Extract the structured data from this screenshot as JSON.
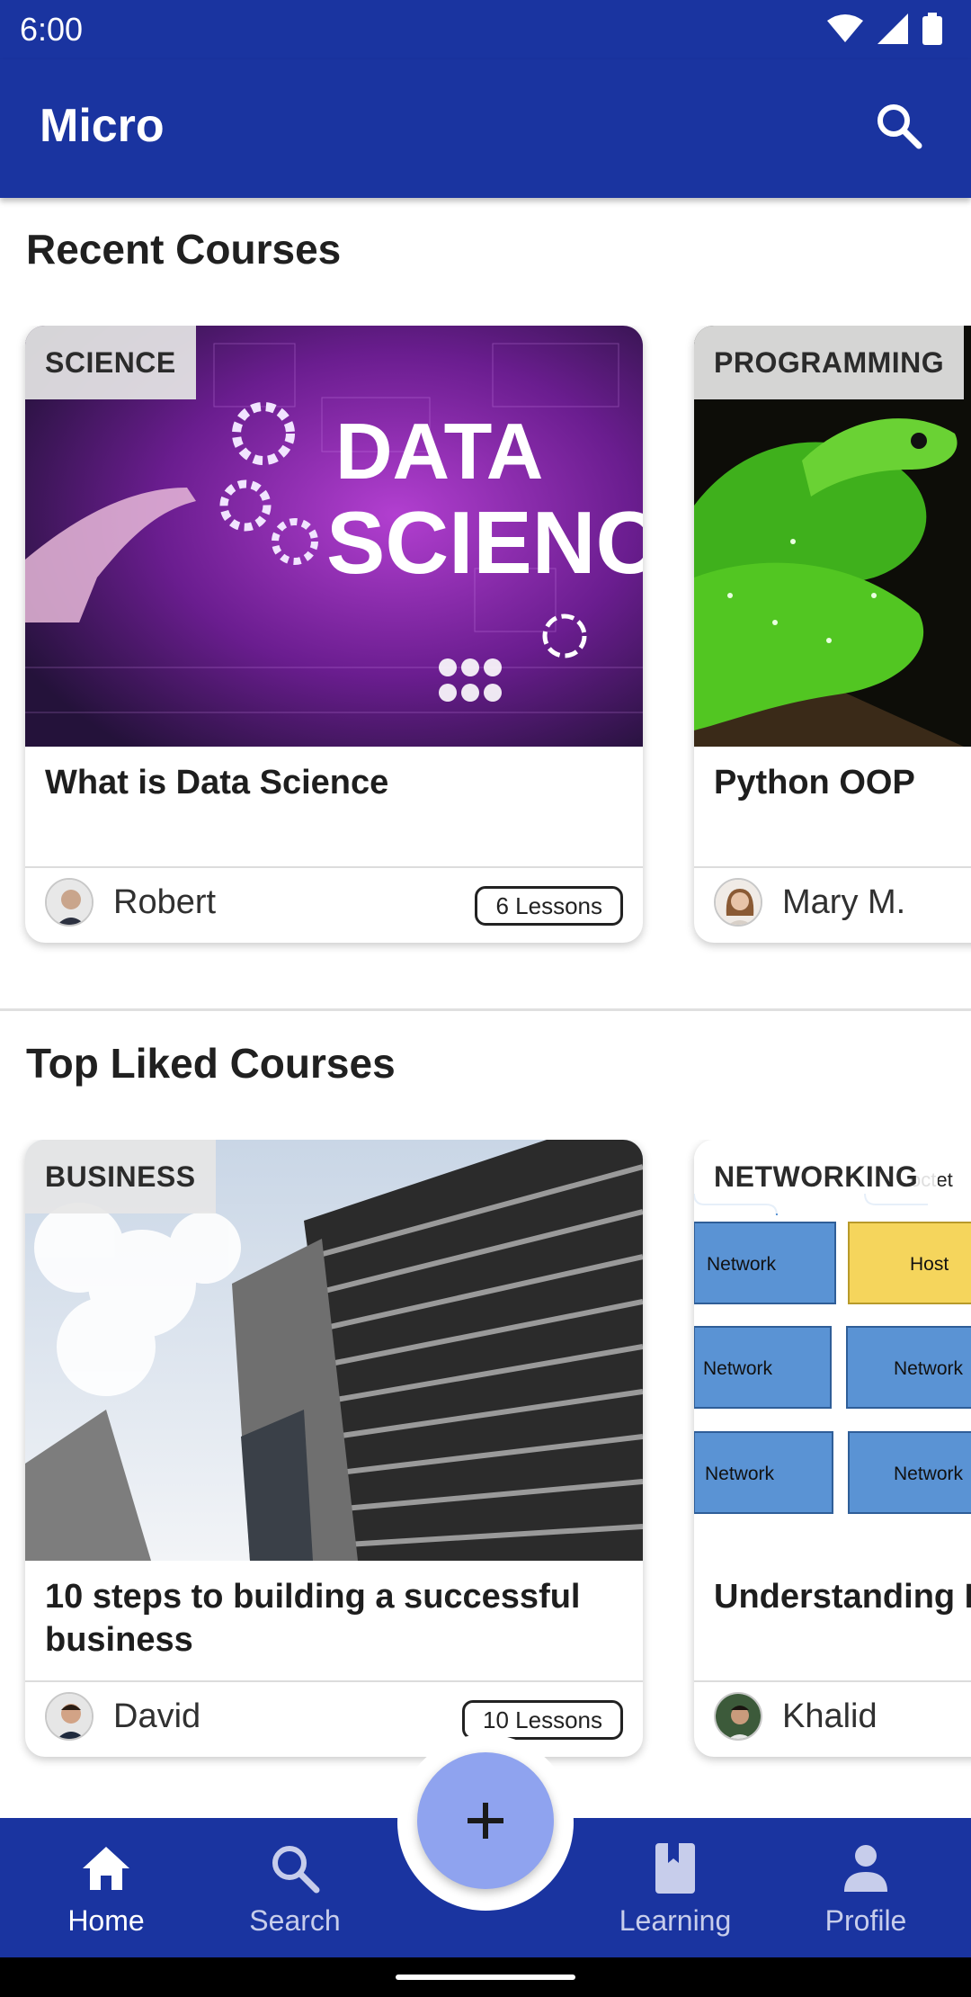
{
  "status_bar": {
    "time": "6:00",
    "icons": [
      "wifi-icon",
      "signal-icon",
      "battery-icon"
    ]
  },
  "app_bar": {
    "title": "Micro",
    "search_icon": "search-icon"
  },
  "recent": {
    "title": "Recent Courses",
    "cards": [
      {
        "category": "SCIENCE",
        "image_text_1": "DATA",
        "image_text_2": "SCIENCE",
        "title": "What is Data Science",
        "author": "Robert",
        "lessons": "6 Lessons"
      },
      {
        "category": "PROGRAMMING",
        "title": "Python OOP",
        "author": "Mary M."
      }
    ]
  },
  "top_liked": {
    "title": "Top Liked Courses",
    "cards": [
      {
        "category": "BUSINESS",
        "title": "10 steps to building a successful business",
        "author": "David",
        "lessons": "10 Lessons"
      },
      {
        "category": "NETWORKING",
        "title": "Understanding I",
        "author": "Khalid",
        "diagram": {
          "octet_label": "octet",
          "cells": [
            "Network",
            "Host",
            "Network",
            "Network",
            "Network",
            "Network"
          ]
        }
      }
    ]
  },
  "bottom_nav": {
    "items": [
      {
        "label": "Home",
        "icon": "home-icon",
        "active": true
      },
      {
        "label": "Search",
        "icon": "search-icon",
        "active": false
      },
      {
        "label": "Learning",
        "icon": "book-icon",
        "active": false
      },
      {
        "label": "Profile",
        "icon": "person-icon",
        "active": false
      }
    ],
    "fab_icon": "plus-icon"
  },
  "colors": {
    "primary": "#1a34a0",
    "fab": "#8fa3ef",
    "network_blue": "#5a93d4",
    "host_yellow": "#f5d55c"
  }
}
